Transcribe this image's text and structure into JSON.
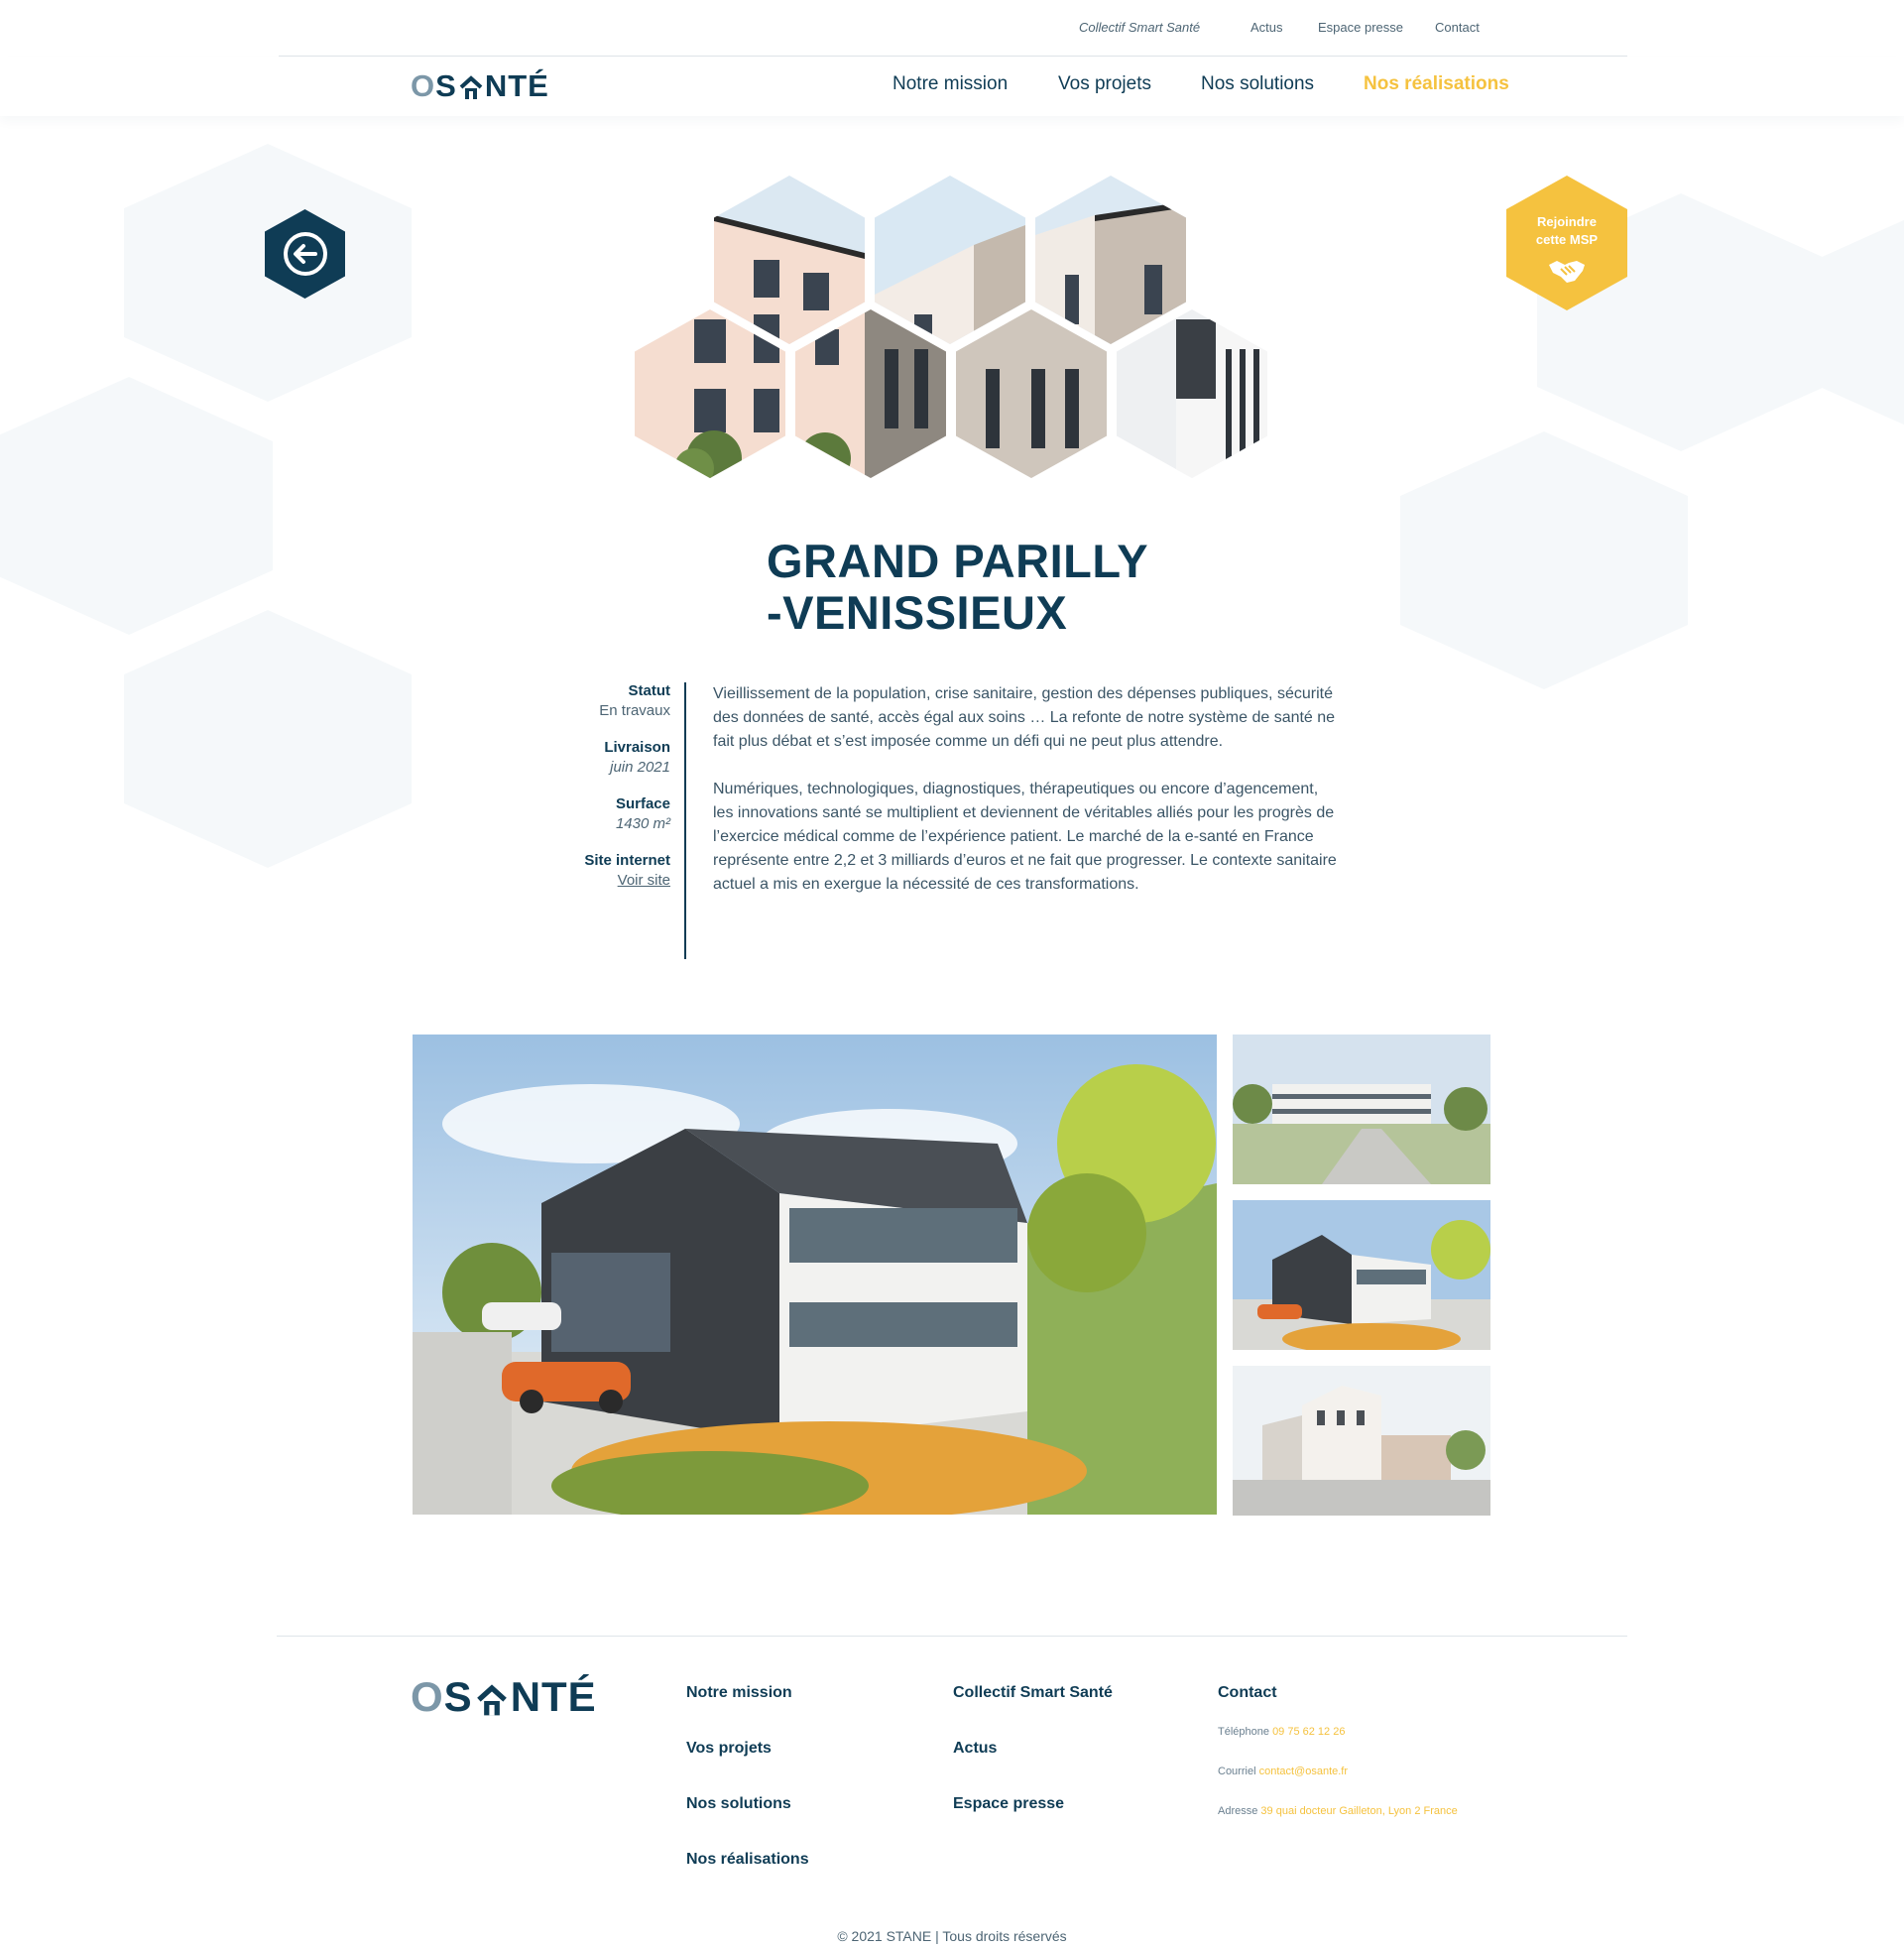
{
  "topbar": {
    "collectif": "Collectif Smart Santé",
    "actus": "Actus",
    "presse": "Espace presse",
    "contact": "Contact"
  },
  "brand": {
    "logo_o": "O",
    "logo_s": "S",
    "logo_rest": "NTÉ"
  },
  "nav": {
    "mission": "Notre mission",
    "projets": "Vos projets",
    "solutions": "Nos solutions",
    "realisations": "Nos réalisations"
  },
  "join_button": {
    "line1": "Rejoindre",
    "line2": "cette MSP"
  },
  "project": {
    "title_line1": "GRAND PARILLY",
    "title_line2": "-VENISSIEUX",
    "statut_label": "Statut",
    "statut_value": "En travaux",
    "livraison_label": "Livraison",
    "livraison_value": "juin 2021",
    "surface_label": "Surface",
    "surface_value": "1430 m²",
    "site_label": "Site internet",
    "site_value": "Voir site",
    "paragraph1": "Vieillissement de la population, crise sanitaire, gestion des dépenses publiques, sécurité des données de santé, accès égal aux soins … La refonte de notre système de santé ne fait plus débat et s’est imposée comme un défi qui ne peut plus attendre.",
    "paragraph2": "Numériques, technologiques, diagnostiques, thérapeutiques ou encore d’agencement, les innovations santé se multiplient et deviennent de véritables alliés pour les progrès de l’exercice médical comme de l’expérience patient. Le marché de la e-santé en France représente entre 2,2 et 3 milliards d’euros et ne fait que progresser. Le contexte sanitaire actuel a mis en exergue la nécessité de ces transformations."
  },
  "footer": {
    "mission": "Notre mission",
    "projets": "Vos projets",
    "solutions": "Nos solutions",
    "realisations": "Nos réalisations",
    "collectif": "Collectif Smart Santé",
    "actus": "Actus",
    "presse": "Espace presse",
    "contact_title": "Contact",
    "tel_label": "Téléphone",
    "tel_value": "09 75 62 12 26",
    "mail_label": "Courriel",
    "mail_value": "contact@osante.fr",
    "addr_label": "Adresse",
    "addr_value": "39 quai docteur Gailleton, Lyon 2 France",
    "copyright": "© 2021 STANE | Tous droits réservés"
  },
  "colors": {
    "navy": "#0f3c55",
    "yellow": "#f5c23f",
    "grey_blue": "#7c97a8"
  },
  "icons": {
    "back": "arrow-left-icon",
    "join": "handshake-icon",
    "logo_house": "house-icon"
  }
}
